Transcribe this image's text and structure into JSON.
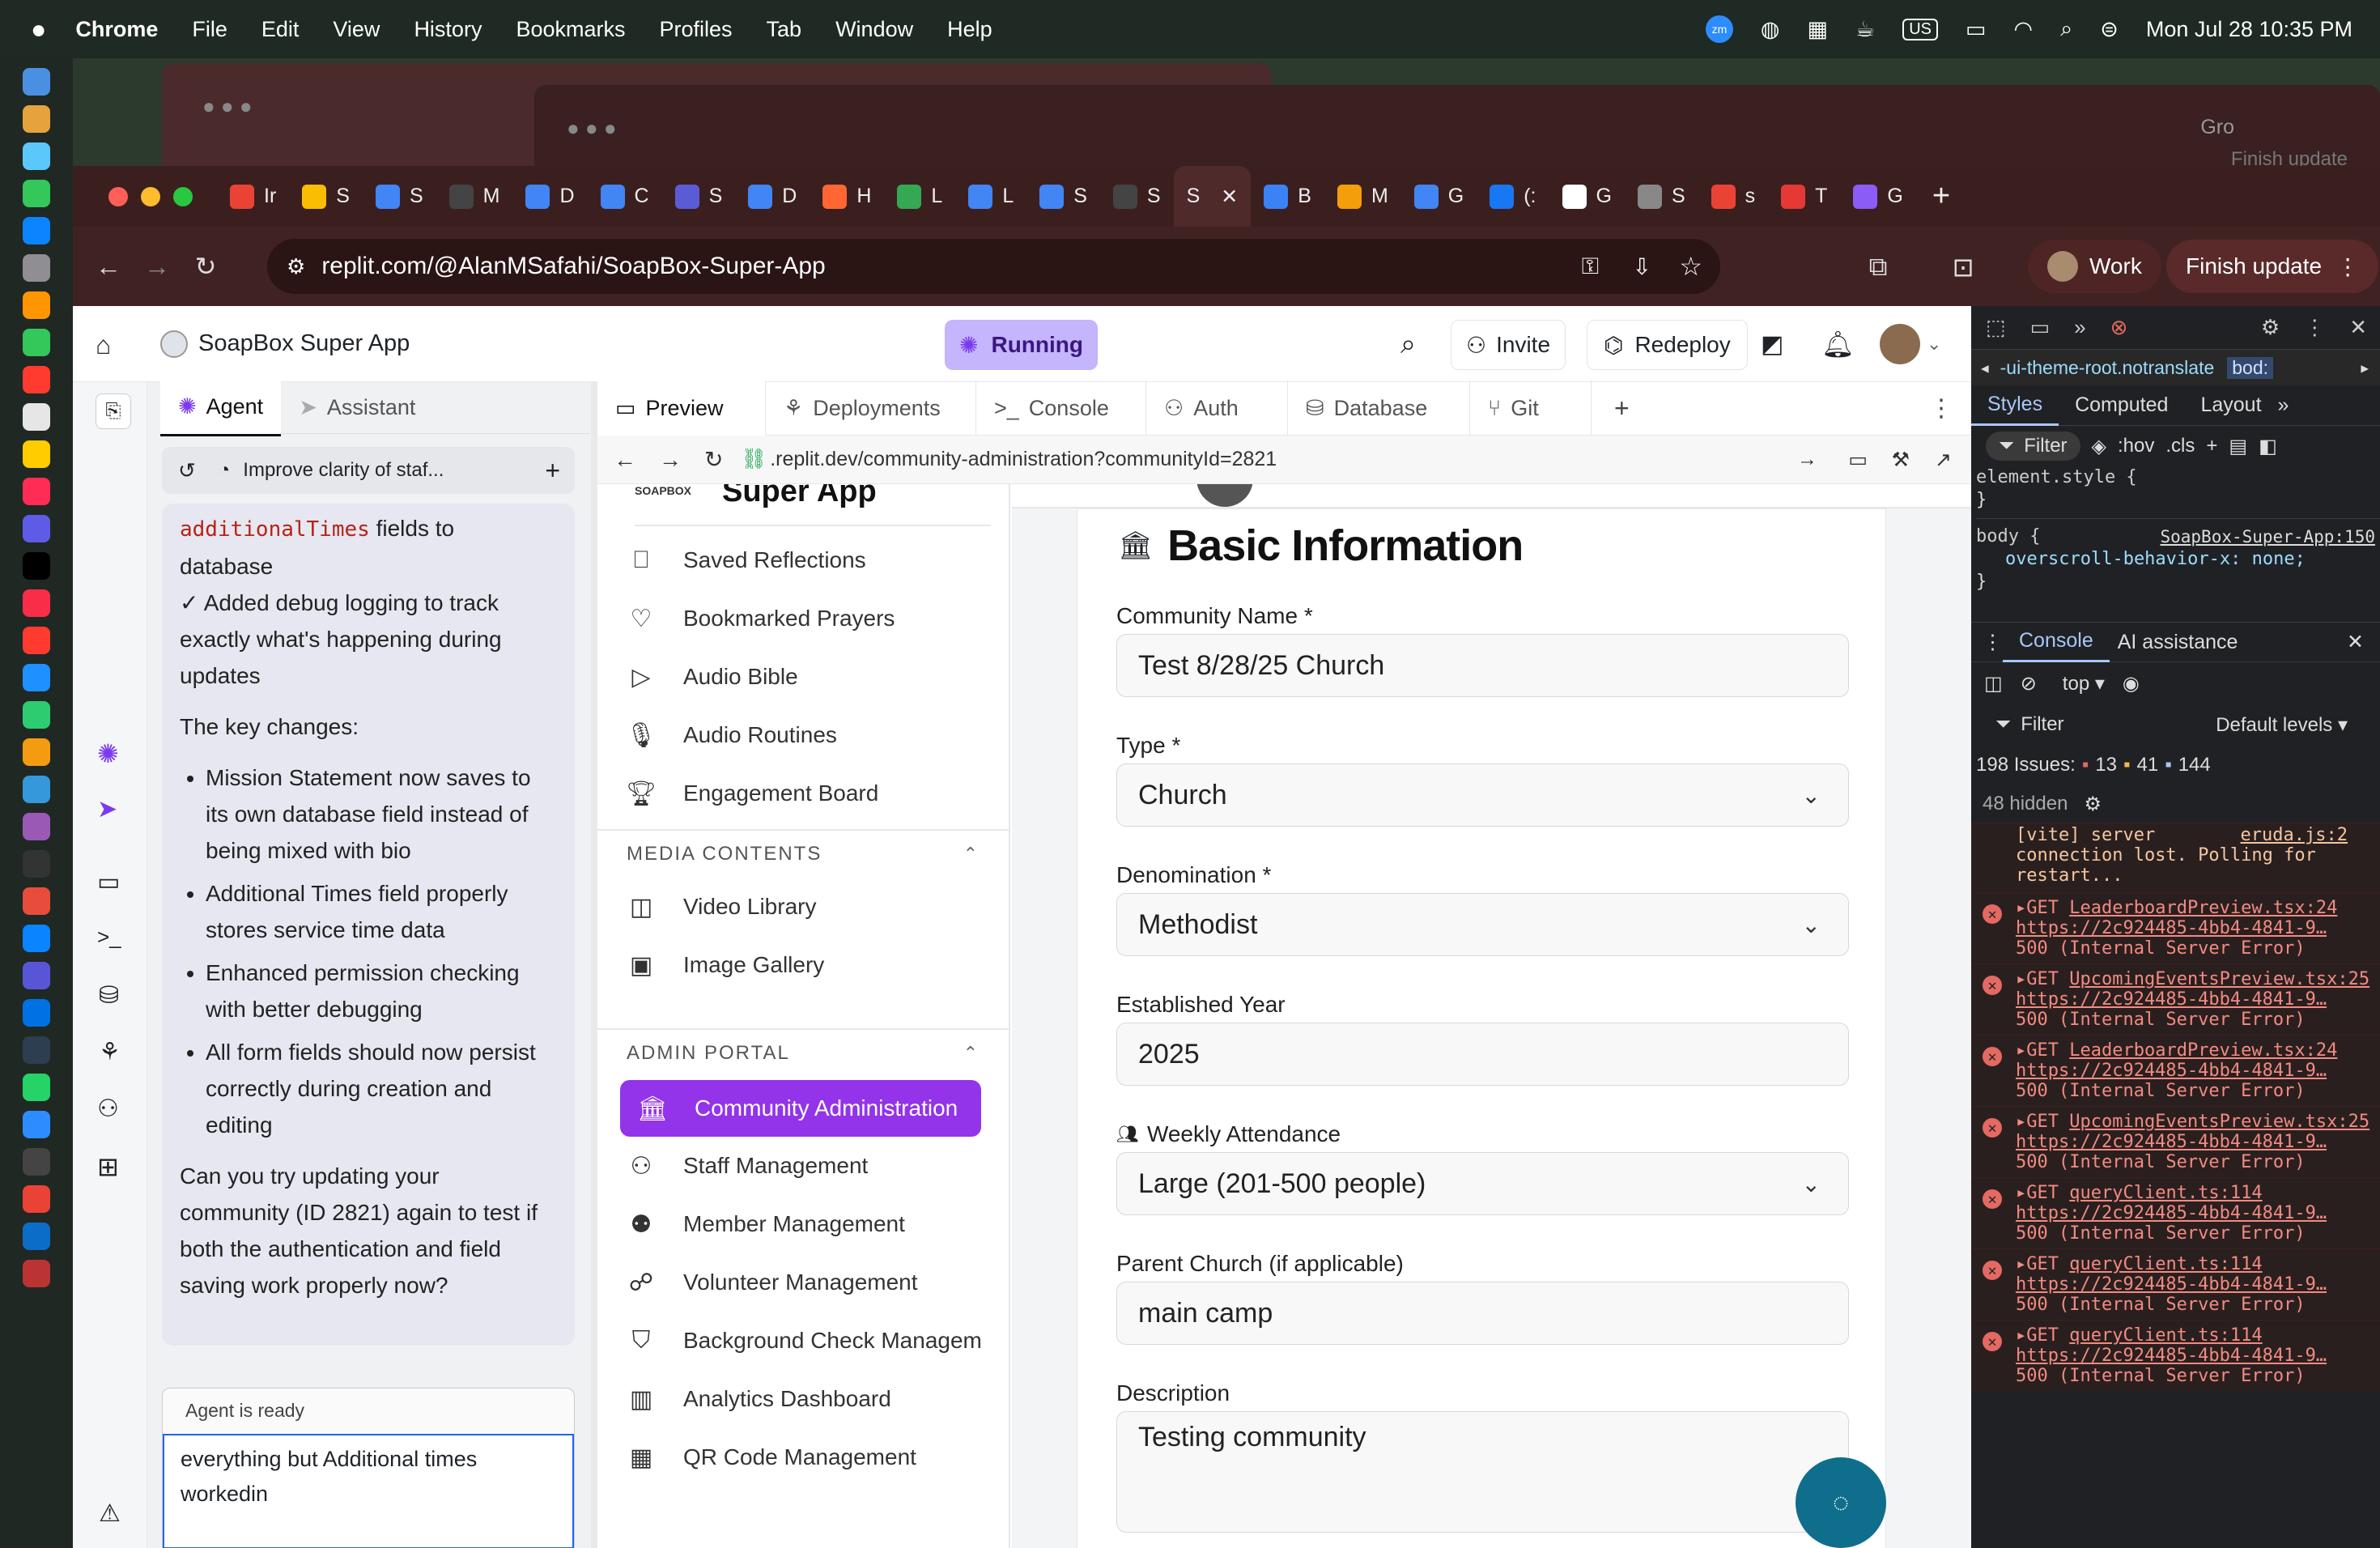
{
  "menubar": {
    "app": "Chrome",
    "menus": [
      "File",
      "Edit",
      "View",
      "History",
      "Bookmarks",
      "Profiles",
      "Tab",
      "Window",
      "Help"
    ],
    "clock": "Mon Jul 28  10:35 PM",
    "us": "US"
  },
  "tabs": [
    "Ir",
    "S",
    "S",
    "M",
    "D",
    "C",
    "S",
    "D",
    "H",
    "L",
    "L",
    "S",
    "S",
    "S",
    "B",
    "M",
    "G",
    "(:",
    "G",
    "S",
    "s",
    "T",
    "G"
  ],
  "background_windows": {
    "tab_label": "Gro",
    "update_label": "Finish update"
  },
  "browser": {
    "url": "replit.com/@AlanMSafahi/SoapBox-Super-App",
    "work": "Work",
    "finish_update": "Finish update"
  },
  "replit": {
    "project": "SoapBox Super App",
    "status": "Running",
    "invite": "Invite",
    "redeploy": "Redeploy",
    "left_tabs": [
      "Agent",
      "Assistant"
    ],
    "thread_title": "Improve clarity of staf...",
    "chat": {
      "code": "additionalTimes",
      "p1_tail": " fields to database",
      "check": "✓ Added debug logging to track exactly what's happening during updates",
      "key_changes": "The key changes:",
      "bullets": [
        "Mission Statement now saves to its own database field instead of being mixed with bio",
        "Additional Times field properly stores service time data",
        "Enhanced permission checking with better debugging",
        "All form fields should now persist correctly during creation and editing"
      ],
      "question": "Can you try updating your community (ID 2821) again to test if both the authentication and field saving work properly now?"
    },
    "agent_status": "Agent is ready",
    "input_value": "everything but Additional times workedin",
    "center_tabs": [
      "Preview",
      "Deployments",
      "Console",
      "Auth",
      "Database",
      "Git"
    ],
    "preview_url": ".replit.dev/community-administration?communityId=2821"
  },
  "app": {
    "logo_small": "SOAPBOX",
    "logo_big": "Super App",
    "nav_top": [
      "Saved Reflections",
      "Bookmarked Prayers",
      "Audio Bible",
      "Audio Routines",
      "Engagement Board"
    ],
    "media_header": "MEDIA CONTENTS",
    "media": [
      "Video Library",
      "Image Gallery"
    ],
    "admin_header": "ADMIN PORTAL",
    "admin": [
      "Community Administration",
      "Staff Management",
      "Member Management",
      "Volunteer Management",
      "Background Check Managem",
      "Analytics Dashboard",
      "QR Code Management"
    ],
    "section_title": "Basic Information",
    "fields": {
      "name_label": "Community Name *",
      "name_value": "Test 8/28/25 Church",
      "type_label": "Type *",
      "type_value": "Church",
      "denom_label": "Denomination *",
      "denom_value": "Methodist",
      "year_label": "Established Year",
      "year_value": "2025",
      "attend_label": "Weekly Attendance",
      "attend_value": "Large (201-500 people)",
      "parent_label": "Parent Church (if applicable)",
      "parent_value": "main camp",
      "desc_label": "Description",
      "desc_value": "Testing community"
    }
  },
  "devtools": {
    "breadcrumb": "-ui-theme-root.notranslate",
    "breadcrumb2": "bod:",
    "panel_tabs": [
      "Styles",
      "Computed",
      "Layout"
    ],
    "filter": "Filter",
    "hov": ":hov",
    "cls": ".cls",
    "element_style": "element.style {",
    "close_brace": "}",
    "body_rule": "body {",
    "body_src": "SoapBox-Super-App:150",
    "body_prop": "overscroll-behavior-x: none;",
    "console_tabs": [
      "Console",
      "AI assistance"
    ],
    "context": "top",
    "default_levels": "Default levels",
    "issues": "198 Issues:",
    "issue_counts": [
      "13",
      "41",
      "144"
    ],
    "hidden": "48 hidden",
    "vite_msg": "[vite] server connection lost. Polling for restart...",
    "vite_src": "eruda.js:2",
    "errors": [
      {
        "file": "LeaderboardPreview.tsx:24",
        "url": "https://2c924485-4bb4-4841-9…",
        "status": "500 (Internal Server Error)"
      },
      {
        "file": "UpcomingEventsPreview.tsx:25",
        "url": "https://2c924485-4bb4-4841-9…",
        "status": "500 (Internal Server Error)"
      },
      {
        "file": "LeaderboardPreview.tsx:24",
        "url": "https://2c924485-4bb4-4841-9…",
        "status": "500 (Internal Server Error)"
      },
      {
        "file": "UpcomingEventsPreview.tsx:25",
        "url": "https://2c924485-4bb4-4841-9…",
        "status": "500 (Internal Server Error)"
      },
      {
        "file": "queryClient.ts:114",
        "url": "https://2c924485-4bb4-4841-9…",
        "status": "500 (Internal Server Error)"
      },
      {
        "file": "queryClient.ts:114",
        "url": "https://2c924485-4bb4-4841-9…",
        "status": "500 (Internal Server Error)"
      },
      {
        "file": "queryClient.ts:114",
        "url": "https://2c924485-4bb4-4841-9…",
        "status": "500 (Internal Server Error)"
      }
    ],
    "get": "GET"
  },
  "colors": {
    "accent": "#9333ea",
    "replit_running": "#c4b5fd",
    "error": "#f28b82"
  }
}
